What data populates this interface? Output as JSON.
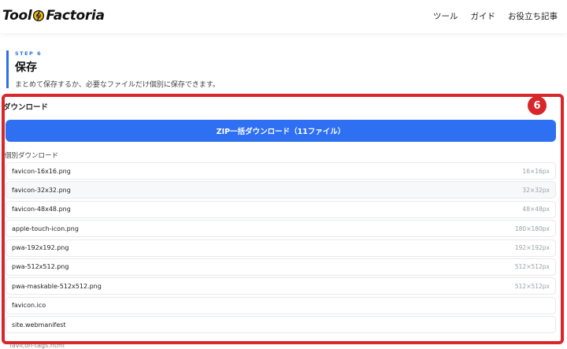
{
  "header": {
    "logo_left": "Tool",
    "logo_right": "Factoria",
    "nav": [
      "ツール",
      "ガイド",
      "お役立ち記事"
    ]
  },
  "step": {
    "label": "STEP 6",
    "title": "保存",
    "description": "まとめて保存するか、必要なファイルだけ個別に保存できます。"
  },
  "download": {
    "section_title": "ダウンロード",
    "zip_button_label": "ZIP一括ダウンロード（11ファイル）",
    "individual_label": "個別ダウンロード",
    "files": [
      {
        "name": "favicon-16x16.png",
        "size": "16×16px"
      },
      {
        "name": "favicon-32x32.png",
        "size": "32×32px"
      },
      {
        "name": "favicon-48x48.png",
        "size": "48×48px"
      },
      {
        "name": "apple-touch-icon.png",
        "size": "180×180px"
      },
      {
        "name": "pwa-192x192.png",
        "size": "192×192px"
      },
      {
        "name": "pwa-512x512.png",
        "size": "512×512px"
      },
      {
        "name": "pwa-maskable-512x512.png",
        "size": "512×512px"
      },
      {
        "name": "favicon.ico",
        "size": ""
      },
      {
        "name": "site.webmanifest",
        "size": ""
      }
    ],
    "cut_off_item": "favicon-tags.html"
  },
  "annotation": {
    "badge_number": "6",
    "color": "#d8262b"
  },
  "colors": {
    "accent": "#2f6ff2"
  }
}
